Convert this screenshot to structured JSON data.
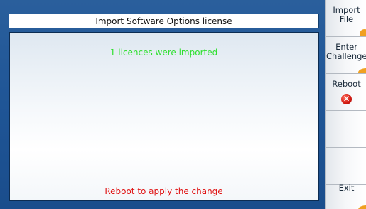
{
  "dialog": {
    "title": "Import Software Options license",
    "success_message": "1 licences were imported",
    "reboot_message": "Reboot to apply the change"
  },
  "softkeys": {
    "import_file": "Import\nFile",
    "enter_challenge": "Enter\nChallenge",
    "reboot": "Reboot",
    "exit": "Exit"
  },
  "icons": {
    "reboot_icon": "reboot-icon"
  },
  "colors": {
    "success": "#2ee02e",
    "warning": "#e01414",
    "panel": "#1f5596",
    "accent": "#f0a021"
  }
}
